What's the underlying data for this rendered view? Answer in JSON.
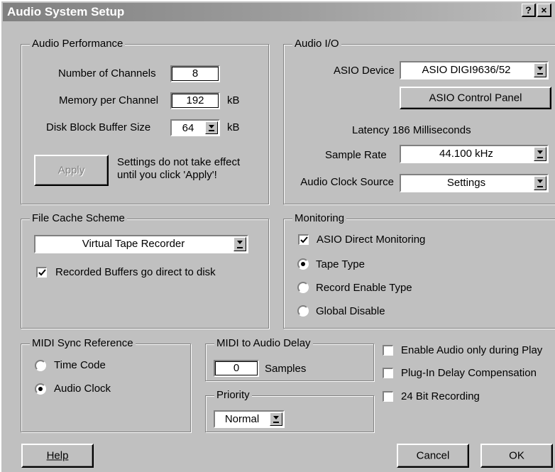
{
  "window": {
    "title": "Audio System Setup",
    "help_glyph": "?",
    "close_glyph": "×"
  },
  "audio_performance": {
    "label": "Audio Performance",
    "channels_label": "Number of Channels",
    "channels_value": "8",
    "memory_label": "Memory per Channel",
    "memory_value": "192",
    "memory_unit": "kB",
    "buffer_label": "Disk Block Buffer Size",
    "buffer_value": "64",
    "buffer_unit": "kB",
    "apply_label": "Apply",
    "note_line1": "Settings do not take effect",
    "note_line2": "until you click 'Apply'!"
  },
  "audio_io": {
    "label": "Audio I/O",
    "device_label": "ASIO Device",
    "device_value": "ASIO DIGI9636/52",
    "control_panel_label": "ASIO Control Panel",
    "latency_text": "Latency 186 Milliseconds",
    "sample_rate_label": "Sample Rate",
    "sample_rate_value": "44.100 kHz",
    "clock_source_label": "Audio Clock Source",
    "clock_source_value": "Settings"
  },
  "file_cache": {
    "label": "File Cache Scheme",
    "scheme_value": "Virtual Tape Recorder",
    "direct_disk_label": "Recorded Buffers go direct to disk",
    "direct_disk_checked": true
  },
  "monitoring": {
    "label": "Monitoring",
    "asio_direct_label": "ASIO Direct Monitoring",
    "asio_direct_checked": true,
    "options": [
      {
        "label": "Tape Type",
        "selected": true
      },
      {
        "label": "Record Enable Type",
        "selected": false
      },
      {
        "label": "Global Disable",
        "selected": false
      }
    ]
  },
  "midi_sync": {
    "label": "MIDI Sync Reference",
    "options": [
      {
        "label": "Time Code",
        "selected": false
      },
      {
        "label": "Audio Clock",
        "selected": true
      }
    ]
  },
  "midi_delay": {
    "label": "MIDI to Audio Delay",
    "value": "0",
    "unit": "Samples"
  },
  "priority": {
    "label": "Priority",
    "value": "Normal"
  },
  "options": [
    {
      "label": "Enable Audio only during Play",
      "checked": false
    },
    {
      "label": "Plug-In Delay Compensation",
      "checked": false
    },
    {
      "label": "24 Bit Recording",
      "checked": false
    }
  ],
  "buttons": {
    "help": "Help",
    "cancel": "Cancel",
    "ok": "OK"
  }
}
